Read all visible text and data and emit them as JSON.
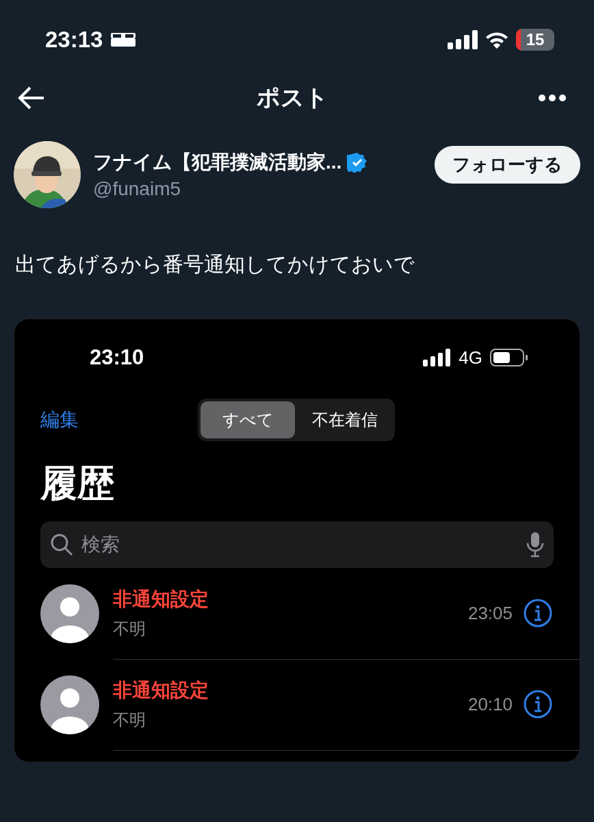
{
  "status_bar": {
    "time": "23:13",
    "battery": "15"
  },
  "header": {
    "title": "ポスト"
  },
  "post": {
    "author": {
      "name": "フナイム【犯罪撲滅活動家...",
      "handle": "@funaim5",
      "verified": true
    },
    "follow_button": "フォローする",
    "text": "出てあげるから番号通知してかけておいで",
    "screenshot": {
      "status_bar": {
        "time": "23:10",
        "network": "4G"
      },
      "edit": "編集",
      "segments": [
        {
          "label": "すべて",
          "selected": true
        },
        {
          "label": "不在着信",
          "selected": false
        }
      ],
      "title": "履歴",
      "search": {
        "placeholder": "検索"
      },
      "calls": [
        {
          "name": "非通知設定",
          "type": "不明",
          "time": "23:05",
          "missed": true
        },
        {
          "name": "非通知設定",
          "type": "不明",
          "time": "20:10",
          "missed": true
        }
      ]
    }
  }
}
